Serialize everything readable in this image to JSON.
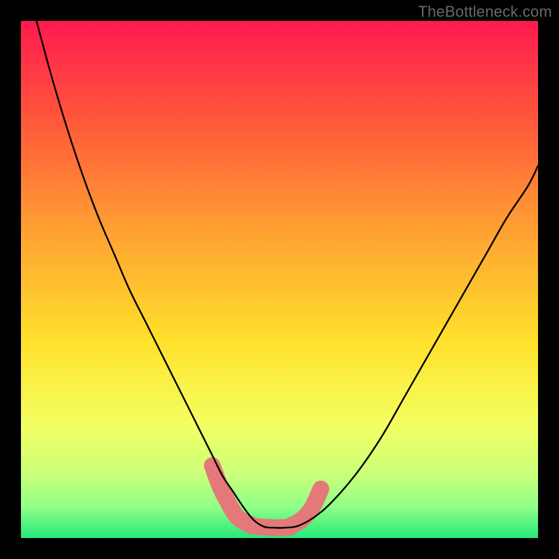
{
  "watermark": "TheBottleneck.com",
  "chart_data": {
    "type": "line",
    "title": "",
    "xlabel": "",
    "ylabel": "",
    "xlim": [
      0,
      100
    ],
    "ylim": [
      0,
      100
    ],
    "grid": false,
    "legend": false,
    "annotations": [],
    "background_gradient": {
      "stops": [
        {
          "offset": 0.0,
          "color": "#ff1a4f"
        },
        {
          "offset": 0.2,
          "color": "#ff5a3a"
        },
        {
          "offset": 0.42,
          "color": "#ffa532"
        },
        {
          "offset": 0.62,
          "color": "#ffe12b"
        },
        {
          "offset": 0.78,
          "color": "#f4ff62"
        },
        {
          "offset": 0.88,
          "color": "#c8ff7a"
        },
        {
          "offset": 0.94,
          "color": "#8fff88"
        },
        {
          "offset": 1.0,
          "color": "#26e87a"
        }
      ]
    },
    "series": [
      {
        "name": "bottleneck-curve",
        "color": "#000000",
        "x": [
          3,
          6,
          9,
          12,
          15,
          18,
          21,
          24,
          27,
          30,
          33,
          35,
          37,
          39,
          41,
          43,
          45,
          47,
          49,
          51,
          54,
          58,
          62,
          66,
          70,
          74,
          78,
          82,
          86,
          90,
          94,
          98,
          100
        ],
        "y": [
          100,
          89,
          79,
          70,
          62,
          55,
          48,
          42,
          36,
          30,
          24,
          20,
          16,
          12,
          9,
          6,
          3.5,
          2.2,
          2.0,
          2.0,
          2.5,
          5,
          9,
          14,
          20,
          27,
          34,
          41,
          48,
          55,
          62,
          68,
          72
        ]
      }
    ],
    "highlight_segments": [
      {
        "name": "left-trough-marker",
        "color": "#e57878",
        "width": 24,
        "x": [
          37,
          38.5,
          40,
          41.5,
          43,
          44.5
        ],
        "y": [
          14,
          10,
          7,
          4.5,
          3.2,
          2.6
        ]
      },
      {
        "name": "bottom-trough-marker",
        "color": "#e57878",
        "width": 24,
        "x": [
          44.5,
          47,
          49.5,
          52
        ],
        "y": [
          2.4,
          2.1,
          2.0,
          2.1
        ]
      },
      {
        "name": "right-trough-marker",
        "color": "#e57878",
        "width": 24,
        "x": [
          52,
          53.5,
          55,
          56.5,
          58
        ],
        "y": [
          2.3,
          3.0,
          4.2,
          6.2,
          9.5
        ]
      }
    ]
  }
}
